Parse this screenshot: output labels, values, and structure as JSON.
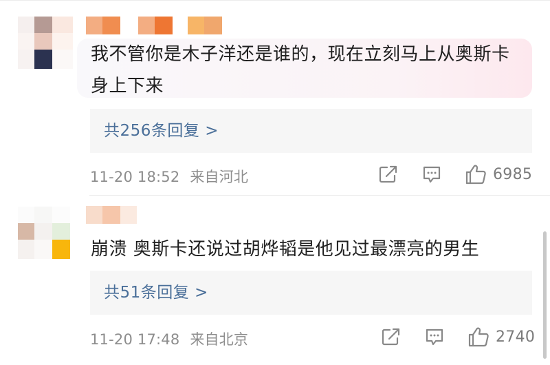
{
  "comments": [
    {
      "text": "我不管你是木子洋还是谁的，现在立刻马上从奥斯卡身上下来",
      "reply_label": "共256条回复 >",
      "timestamp": "11-20 18:52",
      "location": "来自河北",
      "like_count": "6985",
      "highlighted": true
    },
    {
      "text": "崩溃 奥斯卡还说过胡烨韬是他见过最漂亮的男生",
      "reply_label": "共51条回复 >",
      "timestamp": "11-20 17:48",
      "location": "来自北京",
      "like_count": "2740",
      "highlighted": false
    }
  ],
  "icons": {
    "share": "share-icon",
    "comment": "comment-icon",
    "like": "thumbs-up-icon"
  },
  "colors": {
    "link": "#4a6f99",
    "meta_text": "#8d8d8d",
    "reply_bg": "#f6f6f6",
    "bubble_highlight": "#fde8ee"
  }
}
